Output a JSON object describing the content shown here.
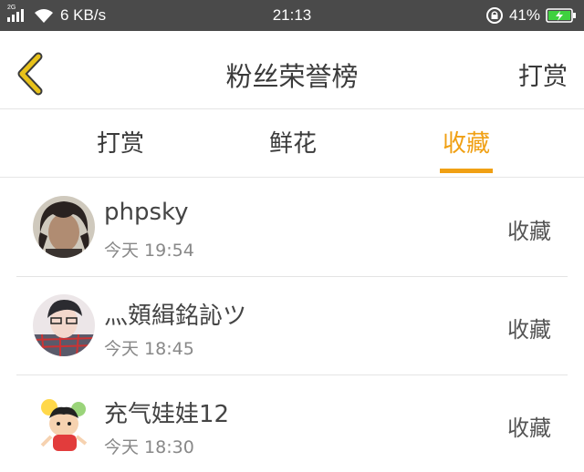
{
  "status_bar": {
    "network_type": "2G",
    "speed": "6 KB/s",
    "time": "21:13",
    "battery": "41%"
  },
  "header": {
    "title": "粉丝荣誉榜",
    "right_action": "打赏",
    "back_icon": "chevron-left-icon"
  },
  "tabs": [
    {
      "label": "打赏",
      "active": false
    },
    {
      "label": "鲜花",
      "active": false
    },
    {
      "label": "收藏",
      "active": true
    }
  ],
  "colors": {
    "accent": "#f0a014",
    "status_bar_bg": "#4a4a4a",
    "back_icon": "#e8c21a"
  },
  "items": [
    {
      "name": "phpsky",
      "time": "今天 19:54",
      "action": "收藏"
    },
    {
      "name": "灬頞緝銘訫ツ",
      "time": "今天 18:45",
      "action": "收藏"
    },
    {
      "name": "充气娃娃12",
      "time": "今天 18:30",
      "action": "收藏"
    }
  ]
}
